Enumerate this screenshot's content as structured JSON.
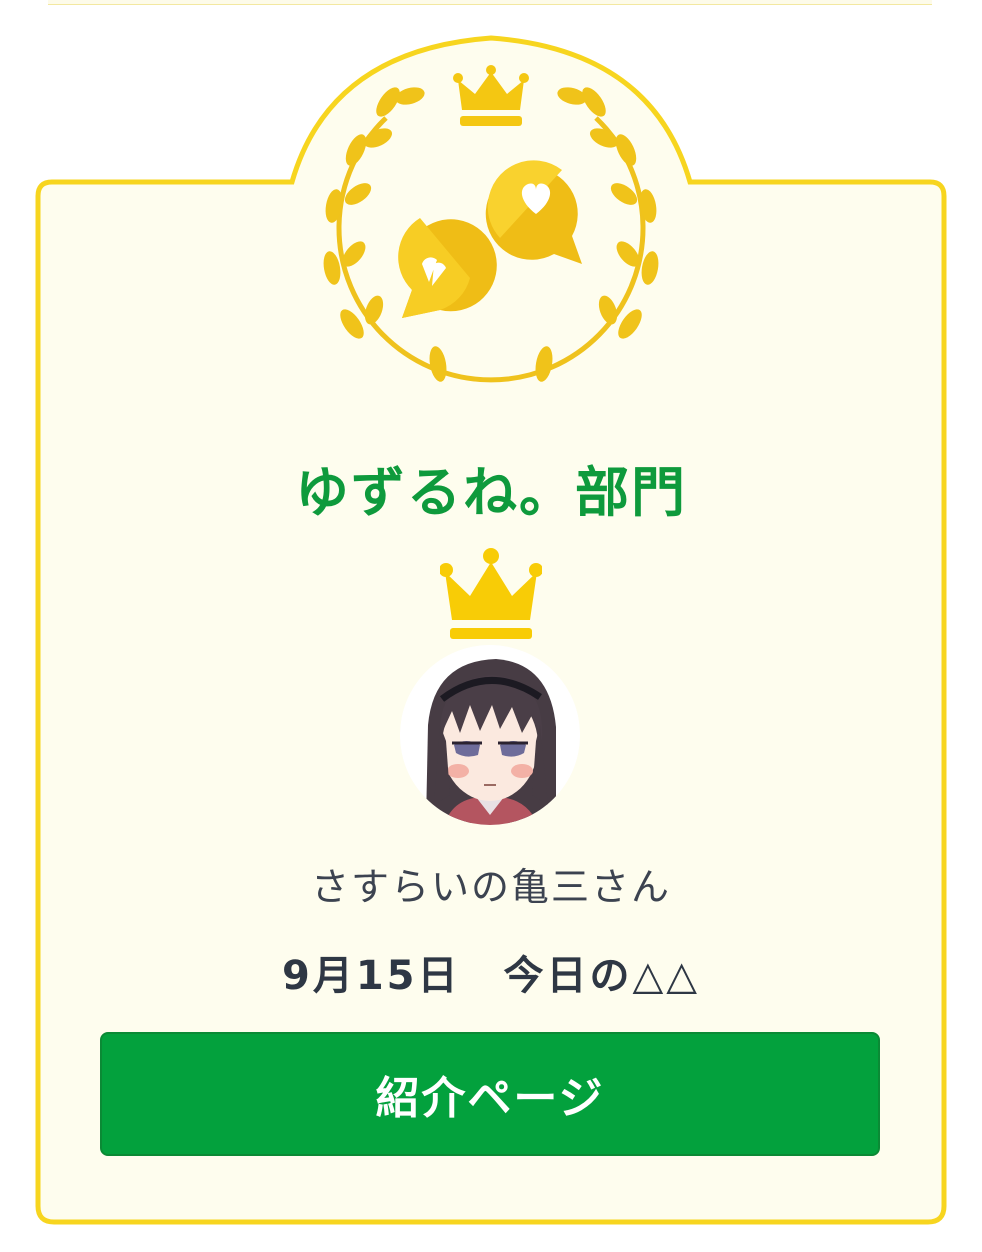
{
  "colors": {
    "card_border": "#f7d51f",
    "card_fill": "#fefdee",
    "emblem_gold": "#f0c31a",
    "crown_gold": "#f8cc06",
    "title_green": "#0e9a3c",
    "button_green": "#03a13d",
    "text_dark": "#2e3744"
  },
  "award": {
    "category_title": "ゆずるね。部門",
    "emblem_icon": "chat-bubbles-heart-laurel-icon",
    "crown_icon": "crown-icon",
    "winner": {
      "avatar_icon": "anime-girl-avatar",
      "name": "さすらいの亀三さん"
    },
    "date_line": "9月15日　今日の△△",
    "button_label": "紹介ページ"
  }
}
